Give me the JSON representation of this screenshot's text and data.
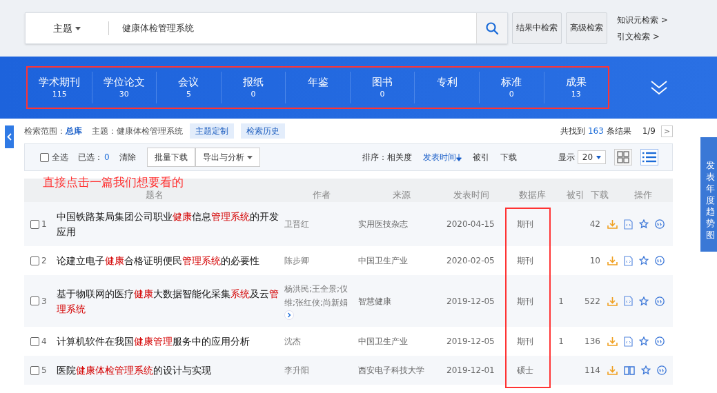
{
  "search": {
    "field": "主题",
    "value": "健康体检管理系统",
    "buttons": [
      "结果中检索",
      "高级检索"
    ],
    "links": [
      "知识元检索 >",
      "引文检索 >"
    ]
  },
  "tabs": [
    {
      "label": "学术期刊",
      "count": "115"
    },
    {
      "label": "学位论文",
      "count": "30"
    },
    {
      "label": "会议",
      "count": "5"
    },
    {
      "label": "报纸",
      "count": "0"
    },
    {
      "label": "年鉴"
    },
    {
      "label": "图书",
      "count": "0"
    },
    {
      "label": "专利"
    },
    {
      "label": "标准",
      "count": "0"
    },
    {
      "label": "成果",
      "count": "13"
    }
  ],
  "filter": {
    "scope_label": "检索范围：",
    "scope": "总库",
    "topic_label": "主题：",
    "topic": "健康体检管理系统",
    "buttons": [
      "主题定制",
      "检索历史"
    ],
    "found_prefix": "共找到",
    "found_count": "163",
    "found_suffix": "条结果",
    "page": "1/9",
    "next": ">"
  },
  "toolbar": {
    "select_all": "全选",
    "select_all_checked": false,
    "selected_label": "已选：",
    "selected_count": "0",
    "clear": "清除",
    "buttons": [
      "批量下载",
      "导出与分析"
    ],
    "sort_label": "排序：",
    "sort": [
      {
        "label": "相关度",
        "selected": false
      },
      {
        "label": "发表时间",
        "selected": true
      },
      {
        "label": "被引",
        "selected": false
      },
      {
        "label": "下载",
        "selected": false
      }
    ],
    "show_label": "显示",
    "page_size": "20",
    "views": [
      {
        "kind": "grid",
        "selected": false
      },
      {
        "kind": "list",
        "selected": true
      }
    ]
  },
  "annotation": "直接点击一篇我们想要看的",
  "columns": [
    "题名",
    "作者",
    "来源",
    "发表时间",
    "数据库",
    "被引",
    "下载",
    "操作"
  ],
  "rows": [
    {
      "checked": false,
      "index": "1",
      "title": [
        {
          "text": "中国铁路某局集团公司职业",
          "highlight": false
        },
        {
          "text": "健康",
          "highlight": true
        },
        {
          "text": "信息",
          "highlight": false
        },
        {
          "text": "管理系统",
          "highlight": true
        },
        {
          "text": "的开发应用",
          "highlight": false
        }
      ],
      "authors": "卫晋红",
      "more_authors": false,
      "source": "实用医技杂志",
      "date": "2020-04-15",
      "database": "期刊",
      "downloads": "42",
      "kind": "html"
    },
    {
      "checked": false,
      "index": "2",
      "title": [
        {
          "text": "论建立电子",
          "highlight": false
        },
        {
          "text": "健康",
          "highlight": true
        },
        {
          "text": "合格证明便民",
          "highlight": false
        },
        {
          "text": "管理系统",
          "highlight": true
        },
        {
          "text": "的必要性",
          "highlight": false
        }
      ],
      "authors": "陈步卿",
      "more_authors": false,
      "source": "中国卫生产业",
      "date": "2020-02-05",
      "database": "期刊",
      "downloads": "10",
      "kind": "html"
    },
    {
      "checked": false,
      "index": "3",
      "title": [
        {
          "text": "基于物联网的医疗",
          "highlight": false
        },
        {
          "text": "健康",
          "highlight": true
        },
        {
          "text": "大数据智能化采集",
          "highlight": false
        },
        {
          "text": "系统",
          "highlight": true
        },
        {
          "text": "及云",
          "highlight": false
        },
        {
          "text": "管理系统",
          "highlight": true
        }
      ],
      "authors": "杨洪民;王全景;仪维;张红侠;尚新娟",
      "more_authors": true,
      "source": "智慧健康",
      "date": "2019-12-05",
      "database": "期刊",
      "cited": "1",
      "downloads": "522",
      "kind": "html"
    },
    {
      "checked": false,
      "index": "4",
      "title": [
        {
          "text": "计算机软件在我国",
          "highlight": false
        },
        {
          "text": "健康管理",
          "highlight": true
        },
        {
          "text": "服务中的应用分析",
          "highlight": false
        }
      ],
      "authors": "沈杰",
      "more_authors": false,
      "source": "中国卫生产业",
      "date": "2019-12-05",
      "database": "期刊",
      "cited": "1",
      "downloads": "136",
      "kind": "html"
    },
    {
      "checked": false,
      "index": "5",
      "title": [
        {
          "text": "医院",
          "highlight": false
        },
        {
          "text": "健康体检管理系统",
          "highlight": true
        },
        {
          "text": "的设计与实现",
          "highlight": false
        }
      ],
      "authors": "李升阳",
      "more_authors": false,
      "source": "西安电子科技大学",
      "date": "2019-12-01",
      "database": "硕士",
      "downloads": "114",
      "kind": "book"
    }
  ],
  "side_tab": "发表年度趋势图"
}
